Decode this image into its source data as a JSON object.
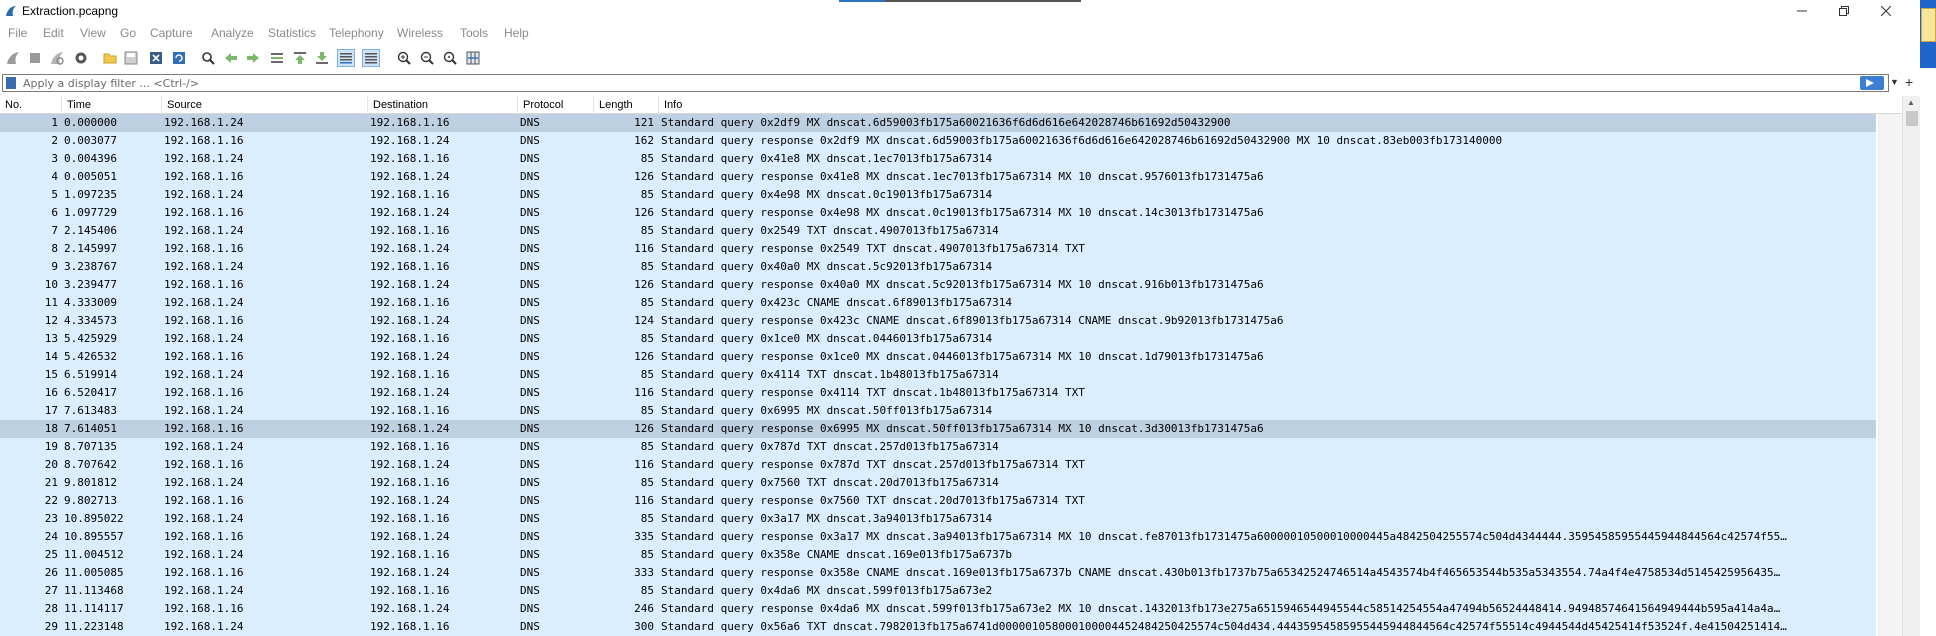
{
  "window": {
    "title": "Extraction.pcapng"
  },
  "menu": [
    "File",
    "Edit",
    "View",
    "Go",
    "Capture",
    "Analyze",
    "Statistics",
    "Telephony",
    "Wireless",
    "Tools",
    "Help"
  ],
  "toolbar": {
    "icons": [
      "shark-fin-start-icon",
      "stop-square-icon",
      "restart-fin-icon",
      "capture-options-gear-icon",
      "open-folder-icon",
      "save-file-icon",
      "close-file-icon",
      "reload-file-icon",
      "find-packet-icon",
      "go-back-icon",
      "go-forward-icon",
      "go-to-packet-icon",
      "go-first-icon",
      "go-last-icon",
      "auto-scroll-icon",
      "colorize-icon",
      "zoom-in-icon",
      "zoom-out-icon",
      "zoom-normal-icon",
      "resize-columns-icon"
    ]
  },
  "filter": {
    "placeholder": "Apply a display filter ... <Ctrl-/>"
  },
  "columns": [
    "No.",
    "Time",
    "Source",
    "Destination",
    "Protocol",
    "Length",
    "Info"
  ],
  "packets": [
    {
      "no": "1",
      "time": "0.000000",
      "src": "192.168.1.24",
      "dst": "192.168.1.16",
      "proto": "DNS",
      "len": "121",
      "info": "Standard query 0x2df9 MX dnscat.6d59003fb175a60021636f6d6d616e642028746b61692d50432900",
      "selected": true
    },
    {
      "no": "2",
      "time": "0.003077",
      "src": "192.168.1.16",
      "dst": "192.168.1.24",
      "proto": "DNS",
      "len": "162",
      "info": "Standard query response 0x2df9 MX dnscat.6d59003fb175a60021636f6d6d616e642028746b61692d50432900 MX 10 dnscat.83eb003fb173140000"
    },
    {
      "no": "3",
      "time": "0.004396",
      "src": "192.168.1.24",
      "dst": "192.168.1.16",
      "proto": "DNS",
      "len": "85",
      "info": "Standard query 0x41e8 MX dnscat.1ec7013fb175a67314"
    },
    {
      "no": "4",
      "time": "0.005051",
      "src": "192.168.1.16",
      "dst": "192.168.1.24",
      "proto": "DNS",
      "len": "126",
      "info": "Standard query response 0x41e8 MX dnscat.1ec7013fb175a67314 MX 10 dnscat.9576013fb1731475a6"
    },
    {
      "no": "5",
      "time": "1.097235",
      "src": "192.168.1.24",
      "dst": "192.168.1.16",
      "proto": "DNS",
      "len": "85",
      "info": "Standard query 0x4e98 MX dnscat.0c19013fb175a67314"
    },
    {
      "no": "6",
      "time": "1.097729",
      "src": "192.168.1.16",
      "dst": "192.168.1.24",
      "proto": "DNS",
      "len": "126",
      "info": "Standard query response 0x4e98 MX dnscat.0c19013fb175a67314 MX 10 dnscat.14c3013fb1731475a6"
    },
    {
      "no": "7",
      "time": "2.145406",
      "src": "192.168.1.24",
      "dst": "192.168.1.16",
      "proto": "DNS",
      "len": "85",
      "info": "Standard query 0x2549 TXT dnscat.4907013fb175a67314"
    },
    {
      "no": "8",
      "time": "2.145997",
      "src": "192.168.1.16",
      "dst": "192.168.1.24",
      "proto": "DNS",
      "len": "116",
      "info": "Standard query response 0x2549 TXT dnscat.4907013fb175a67314 TXT"
    },
    {
      "no": "9",
      "time": "3.238767",
      "src": "192.168.1.24",
      "dst": "192.168.1.16",
      "proto": "DNS",
      "len": "85",
      "info": "Standard query 0x40a0 MX dnscat.5c92013fb175a67314"
    },
    {
      "no": "10",
      "time": "3.239477",
      "src": "192.168.1.16",
      "dst": "192.168.1.24",
      "proto": "DNS",
      "len": "126",
      "info": "Standard query response 0x40a0 MX dnscat.5c92013fb175a67314 MX 10 dnscat.916b013fb1731475a6"
    },
    {
      "no": "11",
      "time": "4.333009",
      "src": "192.168.1.24",
      "dst": "192.168.1.16",
      "proto": "DNS",
      "len": "85",
      "info": "Standard query 0x423c CNAME dnscat.6f89013fb175a67314"
    },
    {
      "no": "12",
      "time": "4.334573",
      "src": "192.168.1.16",
      "dst": "192.168.1.24",
      "proto": "DNS",
      "len": "124",
      "info": "Standard query response 0x423c CNAME dnscat.6f89013fb175a67314 CNAME dnscat.9b92013fb1731475a6"
    },
    {
      "no": "13",
      "time": "5.425929",
      "src": "192.168.1.24",
      "dst": "192.168.1.16",
      "proto": "DNS",
      "len": "85",
      "info": "Standard query 0x1ce0 MX dnscat.0446013fb175a67314"
    },
    {
      "no": "14",
      "time": "5.426532",
      "src": "192.168.1.16",
      "dst": "192.168.1.24",
      "proto": "DNS",
      "len": "126",
      "info": "Standard query response 0x1ce0 MX dnscat.0446013fb175a67314 MX 10 dnscat.1d79013fb1731475a6"
    },
    {
      "no": "15",
      "time": "6.519914",
      "src": "192.168.1.24",
      "dst": "192.168.1.16",
      "proto": "DNS",
      "len": "85",
      "info": "Standard query 0x4114 TXT dnscat.1b48013fb175a67314"
    },
    {
      "no": "16",
      "time": "6.520417",
      "src": "192.168.1.16",
      "dst": "192.168.1.24",
      "proto": "DNS",
      "len": "116",
      "info": "Standard query response 0x4114 TXT dnscat.1b48013fb175a67314 TXT"
    },
    {
      "no": "17",
      "time": "7.613483",
      "src": "192.168.1.24",
      "dst": "192.168.1.16",
      "proto": "DNS",
      "len": "85",
      "info": "Standard query 0x6995 MX dnscat.50ff013fb175a67314"
    },
    {
      "no": "18",
      "time": "7.614051",
      "src": "192.168.1.16",
      "dst": "192.168.1.24",
      "proto": "DNS",
      "len": "126",
      "info": "Standard query response 0x6995 MX dnscat.50ff013fb175a67314 MX 10 dnscat.3d30013fb1731475a6",
      "selected": true
    },
    {
      "no": "19",
      "time": "8.707135",
      "src": "192.168.1.24",
      "dst": "192.168.1.16",
      "proto": "DNS",
      "len": "85",
      "info": "Standard query 0x787d TXT dnscat.257d013fb175a67314"
    },
    {
      "no": "20",
      "time": "8.707642",
      "src": "192.168.1.16",
      "dst": "192.168.1.24",
      "proto": "DNS",
      "len": "116",
      "info": "Standard query response 0x787d TXT dnscat.257d013fb175a67314 TXT"
    },
    {
      "no": "21",
      "time": "9.801812",
      "src": "192.168.1.24",
      "dst": "192.168.1.16",
      "proto": "DNS",
      "len": "85",
      "info": "Standard query 0x7560 TXT dnscat.20d7013fb175a67314"
    },
    {
      "no": "22",
      "time": "9.802713",
      "src": "192.168.1.16",
      "dst": "192.168.1.24",
      "proto": "DNS",
      "len": "116",
      "info": "Standard query response 0x7560 TXT dnscat.20d7013fb175a67314 TXT"
    },
    {
      "no": "23",
      "time": "10.895022",
      "src": "192.168.1.24",
      "dst": "192.168.1.16",
      "proto": "DNS",
      "len": "85",
      "info": "Standard query 0x3a17 MX dnscat.3a94013fb175a67314"
    },
    {
      "no": "24",
      "time": "10.895557",
      "src": "192.168.1.16",
      "dst": "192.168.1.24",
      "proto": "DNS",
      "len": "335",
      "info": "Standard query response 0x3a17 MX dnscat.3a94013fb175a67314 MX 10 dnscat.fe87013fb1731475a60000010500010000445a4842504255574c504d4344444.35954585955445944844564c42574f55…"
    },
    {
      "no": "25",
      "time": "11.004512",
      "src": "192.168.1.24",
      "dst": "192.168.1.16",
      "proto": "DNS",
      "len": "85",
      "info": "Standard query 0x358e CNAME dnscat.169e013fb175a6737b"
    },
    {
      "no": "26",
      "time": "11.005085",
      "src": "192.168.1.16",
      "dst": "192.168.1.24",
      "proto": "DNS",
      "len": "333",
      "info": "Standard query response 0x358e CNAME dnscat.169e013fb175a6737b CNAME dnscat.430b013fb1737b75a65342524746514a4543574b4f465653544b535a5343554.74a4f4e4758534d5145425956435…"
    },
    {
      "no": "27",
      "time": "11.113468",
      "src": "192.168.1.24",
      "dst": "192.168.1.16",
      "proto": "DNS",
      "len": "85",
      "info": "Standard query 0x4da6 MX dnscat.599f013fb175a673e2"
    },
    {
      "no": "28",
      "time": "11.114117",
      "src": "192.168.1.16",
      "dst": "192.168.1.24",
      "proto": "DNS",
      "len": "246",
      "info": "Standard query response 0x4da6 MX dnscat.599f013fb175a673e2 MX 10 dnscat.1432013fb173e275a6515946544945544c58514254554a47494b56524448414.94948574641564949444b595a414a4a…"
    },
    {
      "no": "29",
      "time": "11.223148",
      "src": "192.168.1.24",
      "dst": "192.168.1.16",
      "proto": "DNS",
      "len": "300",
      "info": "Standard query 0x56a6 TXT dnscat.7982013fb175a6741d000001058000100004452484250425574c504d434.44435954585955445944844564c42574f55514c4944544d45425414f53524f.4e41504251414…"
    }
  ],
  "colors": {
    "row_dns": "#daeeff",
    "row_selected": "#bed1e3",
    "accent": "#2a73c0"
  }
}
